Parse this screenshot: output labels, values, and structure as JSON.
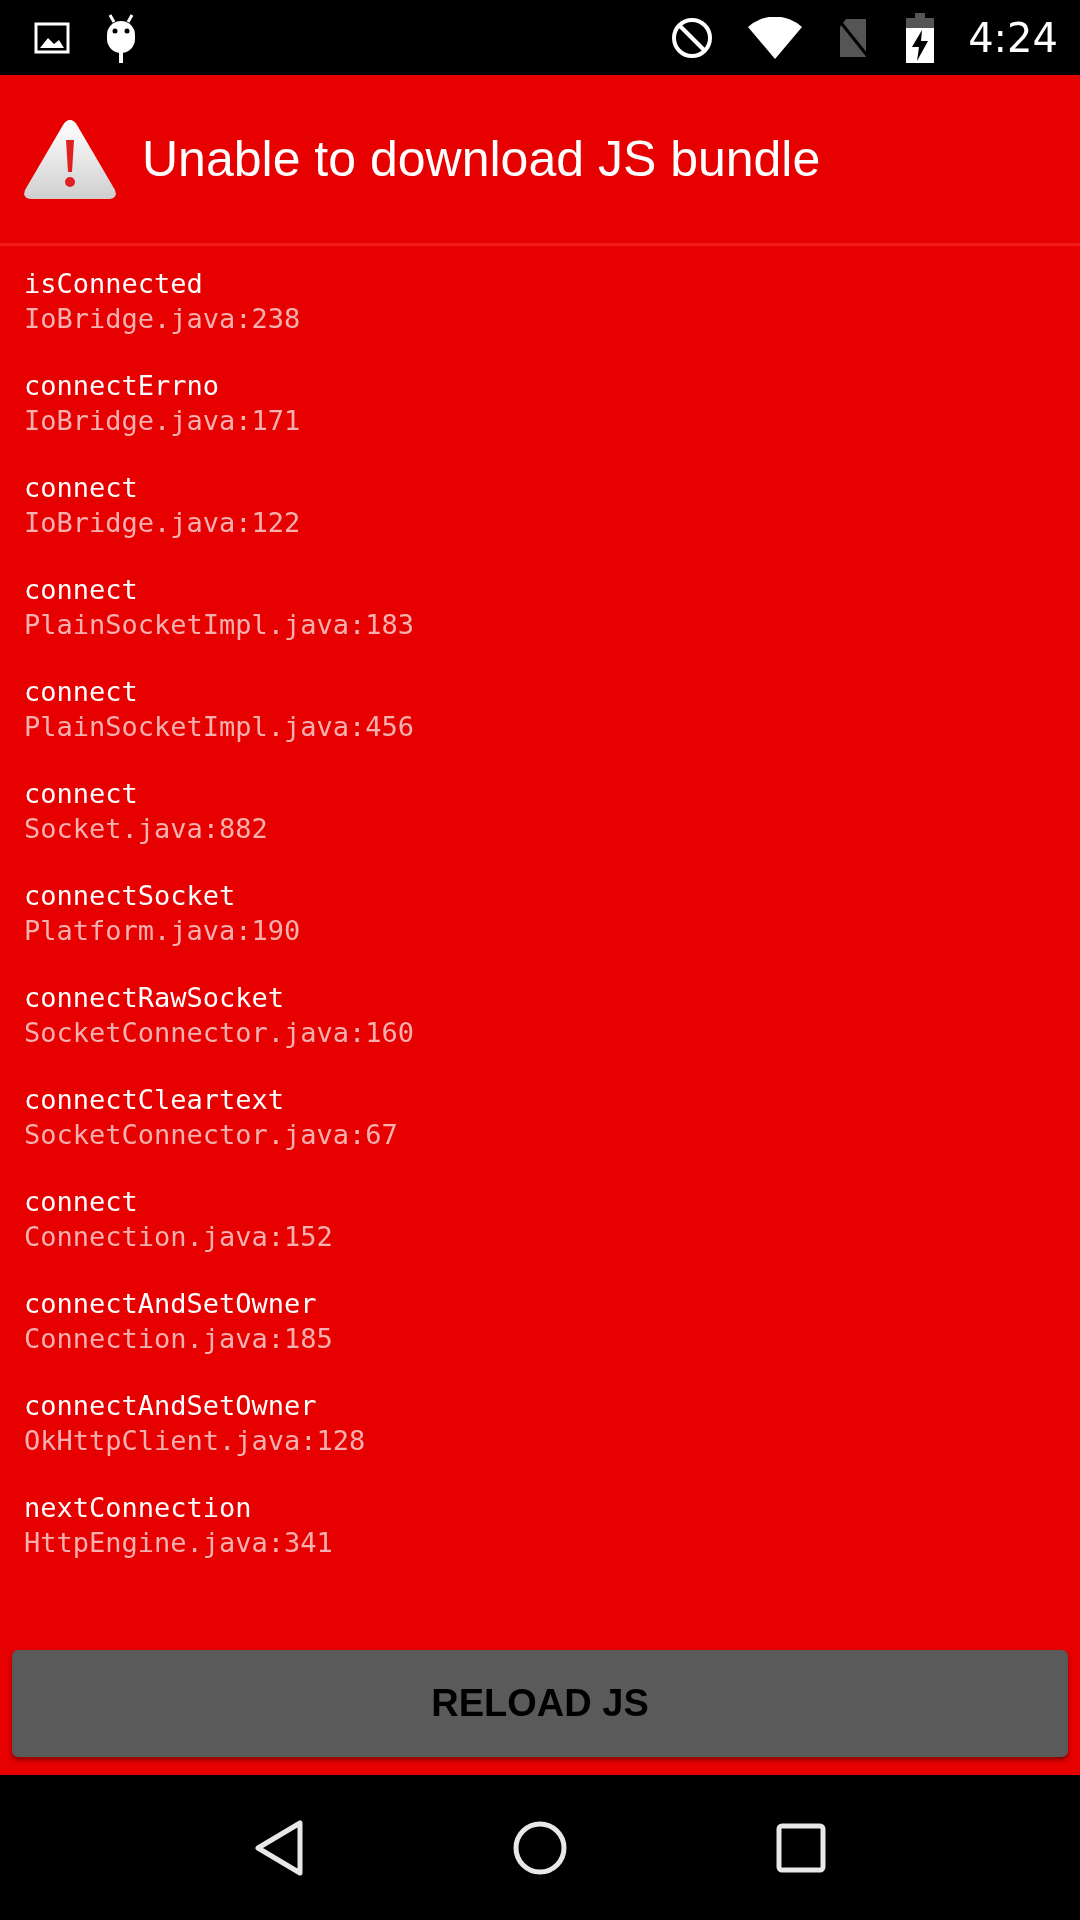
{
  "status_bar": {
    "time": "4:24"
  },
  "title": "Unable to download JS bundle",
  "frames": [
    {
      "method": "isConnected",
      "location": "IoBridge.java:238"
    },
    {
      "method": "connectErrno",
      "location": "IoBridge.java:171"
    },
    {
      "method": "connect",
      "location": "IoBridge.java:122"
    },
    {
      "method": "connect",
      "location": "PlainSocketImpl.java:183"
    },
    {
      "method": "connect",
      "location": "PlainSocketImpl.java:456"
    },
    {
      "method": "connect",
      "location": "Socket.java:882"
    },
    {
      "method": "connectSocket",
      "location": "Platform.java:190"
    },
    {
      "method": "connectRawSocket",
      "location": "SocketConnector.java:160"
    },
    {
      "method": "connectCleartext",
      "location": "SocketConnector.java:67"
    },
    {
      "method": "connect",
      "location": "Connection.java:152"
    },
    {
      "method": "connectAndSetOwner",
      "location": "Connection.java:185"
    },
    {
      "method": "connectAndSetOwner",
      "location": "OkHttpClient.java:128"
    },
    {
      "method": "nextConnection",
      "location": "HttpEngine.java:341"
    }
  ],
  "button": "RELOAD JS"
}
